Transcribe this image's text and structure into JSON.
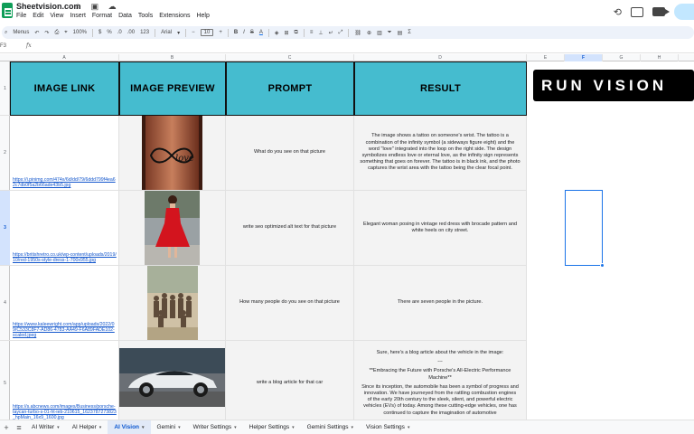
{
  "app": {
    "title": "Sheetvision.com",
    "title_icons": "☆ ▣ ☁",
    "menus": [
      "File",
      "Edit",
      "View",
      "Insert",
      "Format",
      "Data",
      "Tools",
      "Extensions",
      "Help"
    ]
  },
  "toolbar": {
    "menus_label": "Menus",
    "undo": "↶",
    "redo": "↷",
    "print": "⎙",
    "paint": "⌖",
    "zoom": "100%",
    "currency": "$",
    "percent": "%",
    "dec_decrease": ".0",
    "dec_increase": ".00",
    "number_format": "123",
    "font": "Arial",
    "font_size": "10",
    "minus": "−",
    "plus": "+",
    "bold": "B",
    "italic": "I",
    "strike": "S",
    "text_color": "A"
  },
  "formula_bar": {
    "name_box": "F3",
    "fx": "fx"
  },
  "columns": [
    {
      "letter": "A",
      "selected": false
    },
    {
      "letter": "B",
      "selected": false
    },
    {
      "letter": "C",
      "selected": false
    },
    {
      "letter": "D",
      "selected": false
    },
    {
      "letter": "E",
      "selected": false
    },
    {
      "letter": "F",
      "selected": true
    },
    {
      "letter": "G",
      "selected": false
    },
    {
      "letter": "H",
      "selected": false
    }
  ],
  "rows": [
    {
      "number": "1",
      "selected": false
    },
    {
      "number": "2",
      "selected": false
    },
    {
      "number": "3",
      "selected": true
    },
    {
      "number": "4",
      "selected": false
    },
    {
      "number": "5",
      "selected": false
    }
  ],
  "headers": {
    "image_link": "IMAGE LINK",
    "image_preview": "IMAGE PREVIEW",
    "prompt": "PROMPT",
    "result": "RESULT"
  },
  "data_rows": [
    {
      "link": "https://i.pinimg.com/474x/6d/dd/79/6ddd799f4ea62c7db0f5a2b66ade43b5.jpg",
      "image": "tattoo-photo",
      "prompt": "What do you see on that picture",
      "result": "The image shows a tattoo on someone's wrist. The tattoo is a combination of the infinity symbol (a sideways figure eight) and the word \"love\" integrated into the loop on the right side. The design symbolizes endless love or eternal love, as the infinity sign represents something that goes on forever. The tattoo is in black ink, and the photo captures the wrist area with the tattoo being the clear focal point."
    },
    {
      "link": "https://britishretro.co.uk/wp-content/uploads/2019/10/red-1950s-style-dress-1-700x955.jpg",
      "image": "red-dress-photo",
      "prompt": "write seo optimized alt text for that picture",
      "result": "Elegant woman posing in vintage red dress with brocade pattern and white heels on city street."
    },
    {
      "link": "https://www.kaleewright.com/app/uploads/2022/09/C533C8F7-AD86-4783-AA49-F6A89FADE102-scaled.jpeg",
      "image": "group-photo",
      "prompt": "How many people do you see on that picture",
      "result": "There are seven people in the picture."
    },
    {
      "link": "https://s.abcnews.com/images/Business/porsche-taycan-turbo-s-01-ht-ieb-210615_1623787273823_hpMain_16x9_1600.jpg",
      "image": "car-photo",
      "prompt": "write a blog article for that car",
      "result_intro": "Sure, here's a blog article about the vehicle in the image:",
      "result_dashes": "---",
      "result_heading": "**Embracing the Future with Porsche's All-Electric Performance Machine**",
      "result_body": "Since its inception, the automobile has been a symbol of progress and innovation. We have journeyed from the rattling combustion engines of the early 20th century to the sleek, silent, and powerful electric vehicles (EVs) of today. Among these cutting-edge vehicles, one has continued to capture the imagination of automotive"
    }
  ],
  "run_button": {
    "label": "RUN VISION"
  },
  "sheet_tabs": [
    {
      "label": "AI Writer",
      "active": false
    },
    {
      "label": "AI Helper",
      "active": false
    },
    {
      "label": "AI Vision",
      "active": true
    },
    {
      "label": "Gemini",
      "active": false
    },
    {
      "label": "Writer Settings",
      "active": false
    },
    {
      "label": "Helper Settings",
      "active": false
    },
    {
      "label": "Gemini Settings",
      "active": false
    },
    {
      "label": "Vision Settings",
      "active": false
    }
  ],
  "colors": {
    "header_fill": "#45bccf",
    "link": "#1155cc",
    "accent": "#1a73e8"
  },
  "icons": [
    "sheets-logo-icon",
    "star-icon",
    "move-icon",
    "cloud-icon",
    "history-icon",
    "comment-icon",
    "video-icon",
    "share-icon",
    "search-icon",
    "undo-icon",
    "redo-icon",
    "print-icon",
    "add-sheet-icon",
    "all-sheets-icon"
  ]
}
